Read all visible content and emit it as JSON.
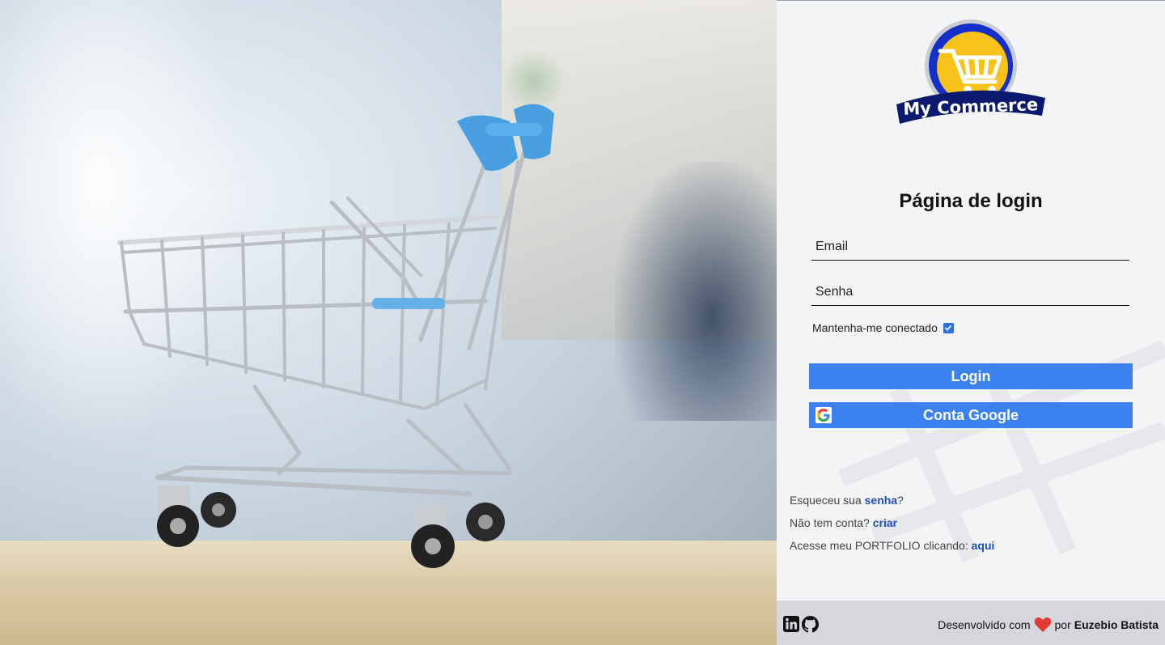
{
  "hero": {
    "image": "shopping-cart-photo"
  },
  "logo": {
    "text": "My Commerce"
  },
  "login": {
    "title": "Página de login",
    "email_placeholder": "Email",
    "password_placeholder": "Senha",
    "remember_label": "Mantenha-me conectado",
    "remember_checked": true,
    "login_button": "Login",
    "google_button": "Conta Google"
  },
  "links": {
    "forgot_prefix": "Esqueceu sua ",
    "forgot_link": "senha",
    "forgot_suffix": "?",
    "signup_prefix": "Não tem conta? ",
    "signup_link": "criar",
    "portfolio_prefix": "Acesse meu PORTFOLIO clicando: ",
    "portfolio_link": "aqui"
  },
  "footer": {
    "credit_prefix": "Desenvolvido com",
    "credit_by": "por",
    "author": "Euzebio Batista",
    "icons": [
      "linkedin-icon",
      "github-icon",
      "heart-icon"
    ]
  },
  "colors": {
    "primary_button": "#3b82f0",
    "link": "#1f4fbf",
    "panel_bg": "#f3f4f6",
    "footer_bg": "#d5d7dc",
    "heart": "#e53935"
  }
}
